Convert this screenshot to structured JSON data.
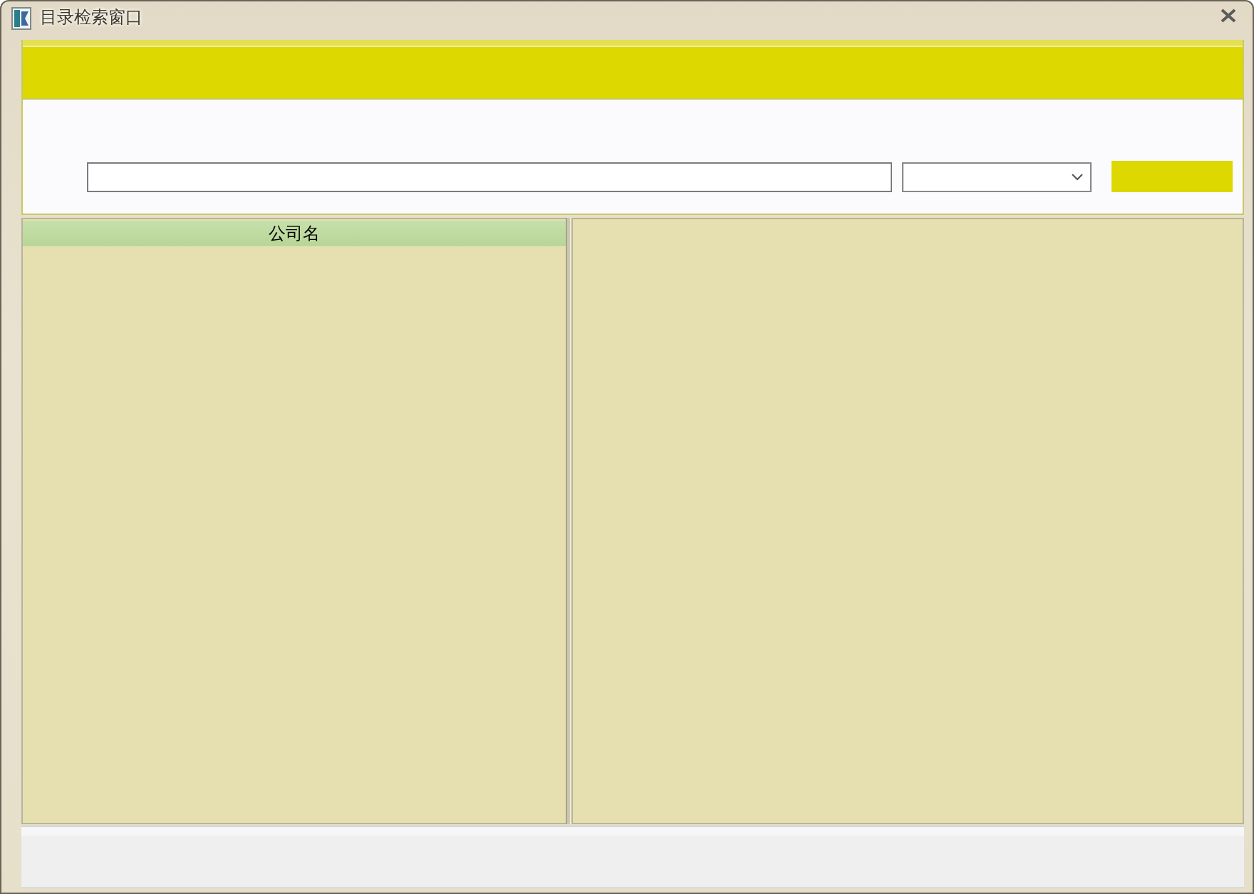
{
  "window": {
    "title": "目录检索窗口"
  },
  "company_list": {
    "columns": [
      "公司名"
    ]
  }
}
